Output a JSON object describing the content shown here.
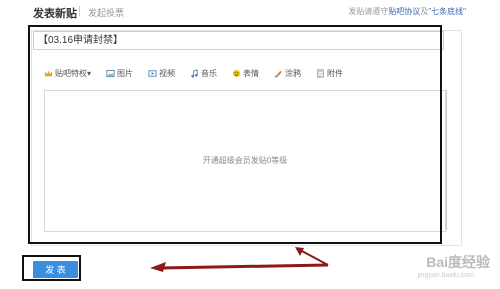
{
  "header": {
    "tab_post": "发表新贴",
    "tab_vote": "发起投票",
    "notice_prefix": "发贴请遵守",
    "notice_link1": "贴吧协议",
    "notice_mid": "及",
    "notice_link2": "\"七条底线\""
  },
  "title_field": {
    "value": "【03.16申请封禁】"
  },
  "toolbar": [
    {
      "label": "贴吧特权▾",
      "icon": "crown-icon"
    },
    {
      "label": "图片",
      "icon": "image-icon"
    },
    {
      "label": "视频",
      "icon": "video-icon"
    },
    {
      "label": "音乐",
      "icon": "music-icon"
    },
    {
      "label": "表情",
      "icon": "smiley-icon"
    },
    {
      "label": "涂鸦",
      "icon": "paint-icon"
    },
    {
      "label": "附件",
      "icon": "attachment-icon"
    }
  ],
  "editor": {
    "placeholder": "开通超级会员发贴0等级"
  },
  "submit": {
    "label": "发 表"
  },
  "watermark": {
    "text": "Bai度经验",
    "sub": "jingyan.baidu.com"
  },
  "colors": {
    "button": "#3b8de0",
    "link": "#3a6ab0",
    "arrow": "#8b1a1a"
  }
}
